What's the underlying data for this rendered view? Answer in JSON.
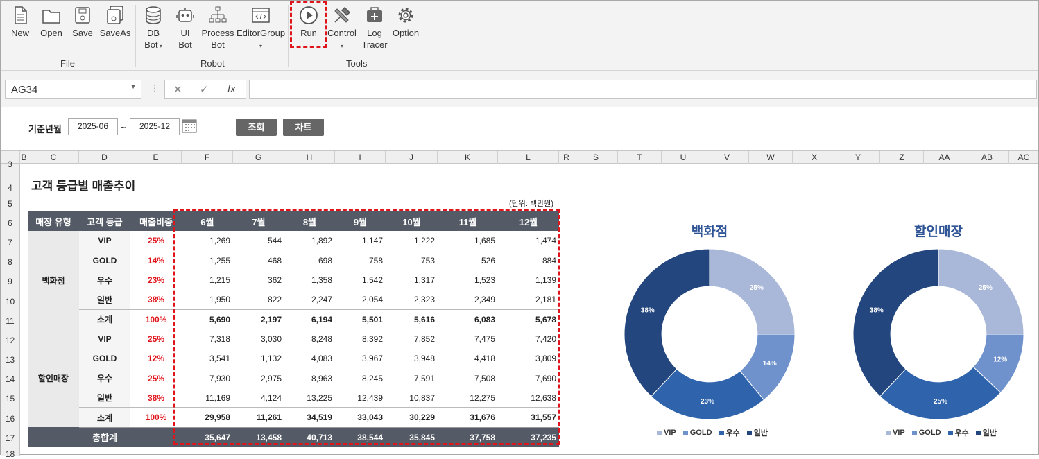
{
  "ribbon": {
    "file": {
      "label": "File",
      "items": [
        {
          "label": "New",
          "icon": "new-file-icon"
        },
        {
          "label": "Open",
          "icon": "open-folder-icon"
        },
        {
          "label": "Save",
          "icon": "save-icon"
        },
        {
          "label": "SaveAs",
          "icon": "save-as-icon"
        }
      ]
    },
    "robot": {
      "label": "Robot",
      "items": [
        {
          "label": "DB\nBot",
          "icon": "database-icon"
        },
        {
          "label": "UI\nBot",
          "icon": "robot-icon"
        },
        {
          "label": "Process\nBot",
          "icon": "process-tree-icon"
        },
        {
          "label": "EditorGroup",
          "icon": "code-editor-icon"
        }
      ]
    },
    "tools": {
      "label": "Tools",
      "items": [
        {
          "label": "Run",
          "icon": "play-icon"
        },
        {
          "label": "Control",
          "icon": "tools-icon"
        },
        {
          "label": "Log\nTracer",
          "icon": "log-tracer-icon"
        },
        {
          "label": "Option",
          "icon": "gear-icon"
        }
      ]
    }
  },
  "formula": {
    "name_box": "AG34",
    "fx": "fx",
    "value": ""
  },
  "controls": {
    "label": "기준년월",
    "from": "2025-06",
    "sep": "~",
    "to": "2025-12",
    "search_btn": "조회",
    "chart_btn": "차트"
  },
  "columns": [
    "B",
    "C",
    "D",
    "E",
    "F",
    "G",
    "H",
    "I",
    "J",
    "K",
    "L",
    "R",
    "S",
    "T",
    "U",
    "V",
    "W",
    "X",
    "Y",
    "Z",
    "AA",
    "AB",
    "AC"
  ],
  "rows": [
    "3",
    "4",
    "5",
    "6",
    "7",
    "8",
    "9",
    "10",
    "11",
    "12",
    "13",
    "14",
    "15",
    "16",
    "17",
    "18"
  ],
  "report": {
    "title": "고객 등급별 매출추이",
    "unit": "(단위: 백만원)",
    "headers": [
      "매장 유형",
      "고객 등급",
      "매출비중",
      "6월",
      "7월",
      "8월",
      "9월",
      "10월",
      "11월",
      "12월"
    ],
    "groups": [
      {
        "store": "백화점",
        "rows": [
          {
            "grade": "VIP",
            "pct": "25%",
            "v": [
              "1,269",
              "544",
              "1,892",
              "1,147",
              "1,222",
              "1,685",
              "1,474"
            ]
          },
          {
            "grade": "GOLD",
            "pct": "14%",
            "v": [
              "1,255",
              "468",
              "698",
              "758",
              "753",
              "526",
              "884"
            ]
          },
          {
            "grade": "우수",
            "pct": "23%",
            "v": [
              "1,215",
              "362",
              "1,358",
              "1,542",
              "1,317",
              "1,523",
              "1,139"
            ]
          },
          {
            "grade": "일반",
            "pct": "38%",
            "v": [
              "1,950",
              "822",
              "2,247",
              "2,054",
              "2,323",
              "2,349",
              "2,181"
            ]
          }
        ],
        "subtotal": {
          "label": "소계",
          "pct": "100%",
          "v": [
            "5,690",
            "2,197",
            "6,194",
            "5,501",
            "5,616",
            "6,083",
            "5,678"
          ]
        }
      },
      {
        "store": "할인매장",
        "rows": [
          {
            "grade": "VIP",
            "pct": "25%",
            "v": [
              "7,318",
              "3,030",
              "8,248",
              "8,392",
              "7,852",
              "7,475",
              "7,420"
            ]
          },
          {
            "grade": "GOLD",
            "pct": "12%",
            "v": [
              "3,541",
              "1,132",
              "4,083",
              "3,967",
              "3,948",
              "4,418",
              "3,809"
            ]
          },
          {
            "grade": "우수",
            "pct": "25%",
            "v": [
              "7,930",
              "2,975",
              "8,963",
              "8,245",
              "7,591",
              "7,508",
              "7,690"
            ]
          },
          {
            "grade": "일반",
            "pct": "38%",
            "v": [
              "11,169",
              "4,124",
              "13,225",
              "12,439",
              "10,837",
              "12,275",
              "12,638"
            ]
          }
        ],
        "subtotal": {
          "label": "소계",
          "pct": "100%",
          "v": [
            "29,958",
            "11,261",
            "34,519",
            "33,043",
            "30,229",
            "31,676",
            "31,557"
          ]
        }
      }
    ],
    "total": {
      "label": "총합계",
      "v": [
        "35,647",
        "13,458",
        "40,713",
        "38,544",
        "35,845",
        "37,758",
        "37,235"
      ]
    }
  },
  "colors": {
    "vip": "#a9b8d8",
    "gold": "#6f91cc",
    "good": "#2f64ad",
    "normal": "#23467e"
  },
  "chart_data": [
    {
      "type": "pie",
      "title": "백화점",
      "categories": [
        "VIP",
        "GOLD",
        "우수",
        "일반"
      ],
      "values": [
        25,
        14,
        23,
        38
      ],
      "labels": [
        "25%",
        "14%",
        "23%",
        "38%"
      ],
      "legend": "bottom"
    },
    {
      "type": "pie",
      "title": "할인매장",
      "categories": [
        "VIP",
        "GOLD",
        "우수",
        "일반"
      ],
      "values": [
        25,
        12,
        25,
        38
      ],
      "labels": [
        "25%",
        "12%",
        "25%",
        "38%"
      ],
      "legend": "bottom"
    }
  ]
}
